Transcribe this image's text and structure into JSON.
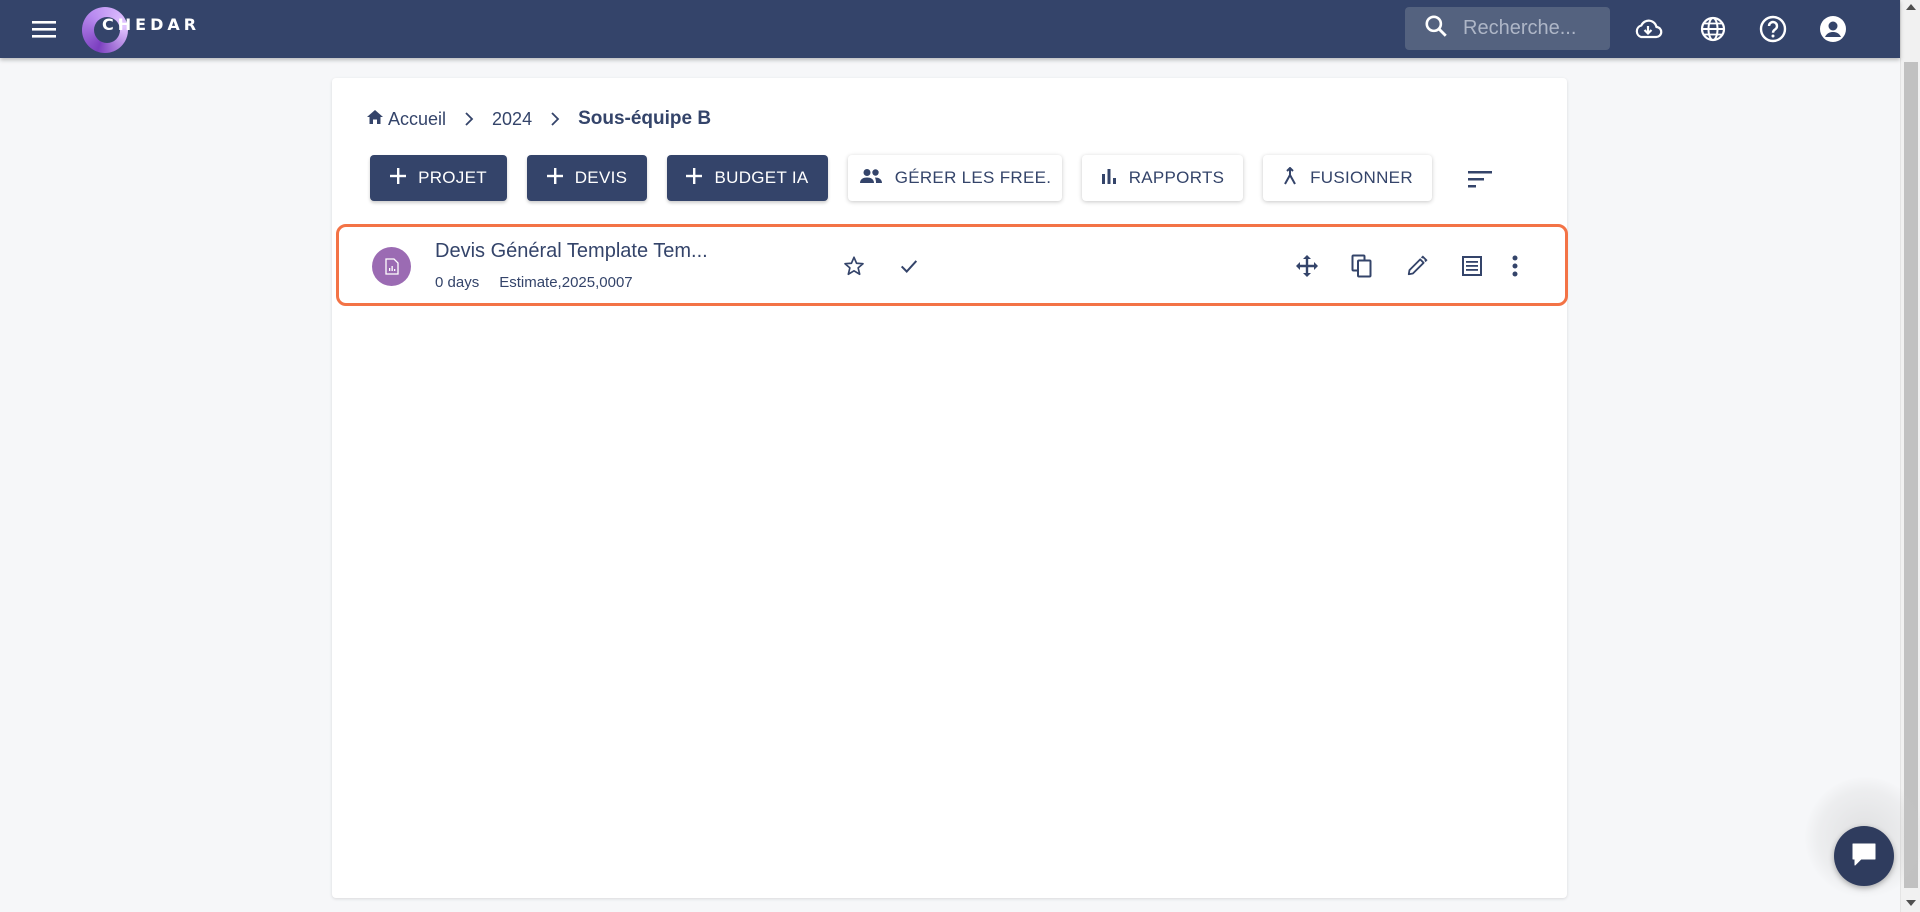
{
  "app": {
    "logo_text": "CHEDAR"
  },
  "topbar": {
    "search_placeholder": "Recherche...",
    "icons": [
      "menu-icon",
      "cloud-download-icon",
      "globe-icon",
      "help-icon",
      "account-circle-icon"
    ]
  },
  "breadcrumb": {
    "home": "Accueil",
    "year": "2024",
    "current": "Sous-équipe B"
  },
  "toolbar": {
    "projet": "PROJET",
    "devis": "DEVIS",
    "budget_ia": "BUDGET IA",
    "gerer": "GÉRER LES FREE.",
    "rapports": "RAPPORTS",
    "fusionner": "FUSIONNER"
  },
  "items": [
    {
      "title": "Devis Général Template Tem...",
      "duration": "0 days",
      "reference": "Estimate,2025,0007",
      "avatar_color": "#9b6bb3"
    }
  ],
  "colors": {
    "primary": "#34446a",
    "highlight_border": "#f37346",
    "chat": "#2f3c5e"
  }
}
